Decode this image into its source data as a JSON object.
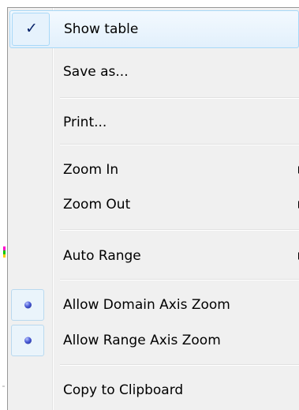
{
  "menu": {
    "items": [
      {
        "label": "Show table",
        "icon": "check-icon",
        "checked": true,
        "has_submenu": false
      },
      {
        "label": "Save as...",
        "icon": "",
        "has_submenu": false
      },
      {
        "label": "Print...",
        "icon": "",
        "has_submenu": false
      },
      {
        "label": "Zoom In",
        "icon": "",
        "has_submenu": true
      },
      {
        "label": "Zoom Out",
        "icon": "",
        "has_submenu": true
      },
      {
        "label": "Auto Range",
        "icon": "",
        "has_submenu": true
      },
      {
        "label": "Allow Domain Axis Zoom",
        "icon": "radio-dot-icon",
        "selected": true,
        "has_submenu": false
      },
      {
        "label": "Allow Range Axis Zoom",
        "icon": "radio-dot-icon",
        "selected": true,
        "has_submenu": false
      },
      {
        "label": "Copy to Clipboard",
        "icon": "",
        "has_submenu": false
      }
    ],
    "check_glyph": "✓",
    "colors": {
      "menu_bg": "#f0f0f0",
      "highlight_border": "#a8d8f7",
      "check_color": "#0a246a",
      "radio_color": "#4a5bd6"
    }
  }
}
